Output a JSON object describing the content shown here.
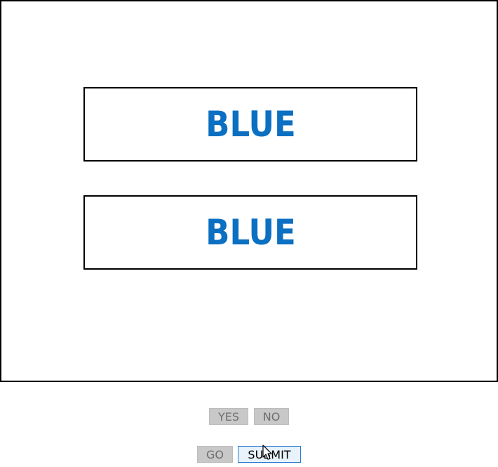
{
  "stimulus": {
    "top_word": "BLUE",
    "top_word_color": "#0b6fc2",
    "bottom_word": "BLUE",
    "bottom_word_color": "#0b6fc2"
  },
  "answer_buttons": {
    "yes_label": "YES",
    "no_label": "NO"
  },
  "action_buttons": {
    "go_label": "GO",
    "submit_label": "SUBMIT"
  },
  "cursor": {
    "icon": "arrow-pointer-icon"
  }
}
